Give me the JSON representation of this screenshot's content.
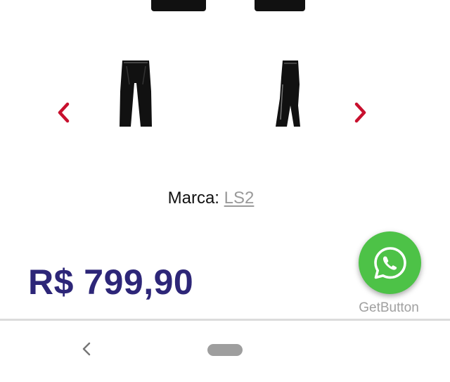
{
  "product": {
    "brand_label": "Marca:",
    "brand_name": "LS2",
    "price": "R$ 799,90"
  },
  "carousel": {
    "prev_icon": "chevron-left-icon",
    "next_icon": "chevron-right-icon",
    "thumbnails": [
      "pants-front-thumbnail",
      "pants-side-thumbnail"
    ]
  },
  "widget": {
    "icon": "whatsapp-icon",
    "label": "GetButton"
  },
  "system_nav": {
    "back_icon": "back-icon",
    "home_icon": "home-pill-icon"
  },
  "colors": {
    "accent_red": "#c8102e",
    "price_blue": "#2d2678",
    "whatsapp_green": "#4dc247"
  }
}
